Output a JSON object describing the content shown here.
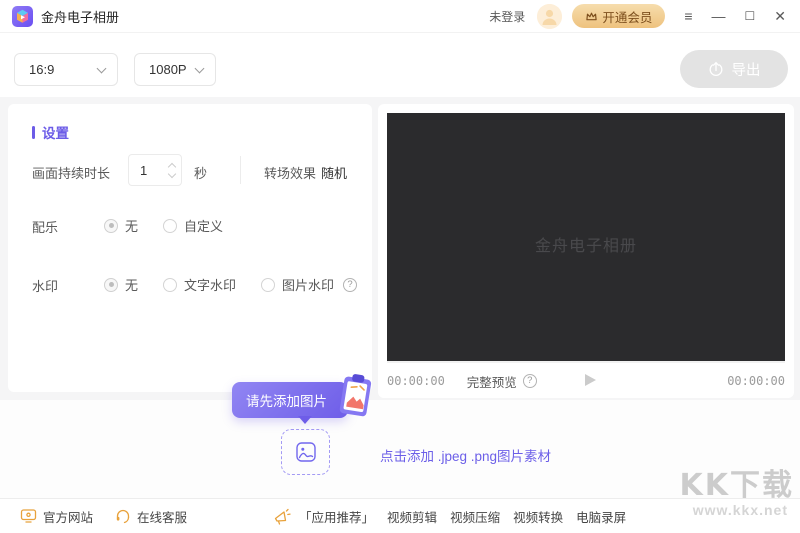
{
  "window": {
    "title": "金舟电子相册",
    "login_status": "未登录",
    "vip_label": "开通会员"
  },
  "icons": {
    "menu": "≡",
    "minimize": "—",
    "maximize": "☐",
    "close": "✕",
    "help": "?"
  },
  "toolbar": {
    "aspect_ratio": "16:9",
    "resolution": "1080P",
    "export_label": "导出"
  },
  "settings": {
    "header": "设置",
    "duration": {
      "label": "画面持续时长",
      "value": "1",
      "unit": "秒"
    },
    "transition": {
      "label": "转场效果",
      "value": "随机"
    },
    "music": {
      "label": "配乐",
      "selected": "无",
      "options": [
        "无",
        "自定义"
      ]
    },
    "watermark": {
      "label": "水印",
      "selected": "无",
      "options": [
        "无",
        "文字水印",
        "图片水印"
      ]
    }
  },
  "preview": {
    "placeholder_watermark": "金舟电子相册",
    "elapsed": "00:00:00",
    "total": "00:00:00",
    "full_preview_label": "完整预览"
  },
  "add_media": {
    "tooltip": "请先添加图片",
    "hint": "点击添加 .jpeg .png图片素材"
  },
  "footer": {
    "website": "官方网站",
    "support": "在线客服",
    "promo_label": "「应用推荐」",
    "promo_links": [
      "视频剪辑",
      "视频压缩",
      "视频转换",
      "电脑录屏"
    ]
  },
  "site_watermark": {
    "name": "KK下载",
    "url": "www.kkx.net"
  },
  "colors": {
    "accent": "#6c5ce7",
    "vip_gold": "#eec27e",
    "footer_orange": "#e8a23c",
    "preview_bg": "#2b2b2d"
  }
}
